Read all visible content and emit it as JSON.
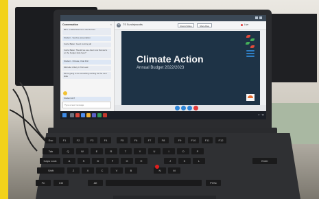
{
  "presentation": {
    "title": "Climate Action",
    "subtitle": "Annual Budget 2022/2023"
  },
  "meeting": {
    "presenter_initials": "TS",
    "presenter_name": "TS Sundripscotts",
    "buttons": [
      "Record Video",
      "Share Files"
    ],
    "live_label": "Live"
  },
  "chat": {
    "header": "Conversation",
    "messages": [
      "Bill v. enable/hide/move the Be here",
      "Student - Service presentation",
      "Carrie Baker: Good morning all",
      "Carrie Baker: Should we see clear now that we're on the budget slide here?",
      "Student - Climate, Chat Poll",
      "Michelle 1 Mary C Tish said",
      "We're going to do something exciting for the next slide",
      "Student HLT"
    ],
    "input_placeholder": "Type a new message"
  },
  "colors": {
    "slide_bg": "#1e3346",
    "accent_green": "#44b05a",
    "accent_red": "#e24a3b",
    "accent_blue": "#2f7fc5",
    "trackpoint": "#e01e1e"
  },
  "keyboard": {
    "keys": [
      "Esc",
      "F1",
      "F2",
      "F3",
      "F4",
      "F5",
      "F6",
      "F7",
      "F8",
      "F9",
      "F10",
      "F11",
      "F12",
      "Q",
      "W",
      "E",
      "R",
      "T",
      "Y",
      "U",
      "I",
      "O",
      "P",
      "A",
      "S",
      "D",
      "F",
      "G",
      "H",
      "J",
      "K",
      "L",
      "Z",
      "X",
      "C",
      "V",
      "B",
      "N",
      "M",
      "Fn",
      "Ctrl",
      "Alt",
      "PrtSc",
      "Shift",
      "Enter",
      "Caps Lock",
      "Tab"
    ]
  }
}
